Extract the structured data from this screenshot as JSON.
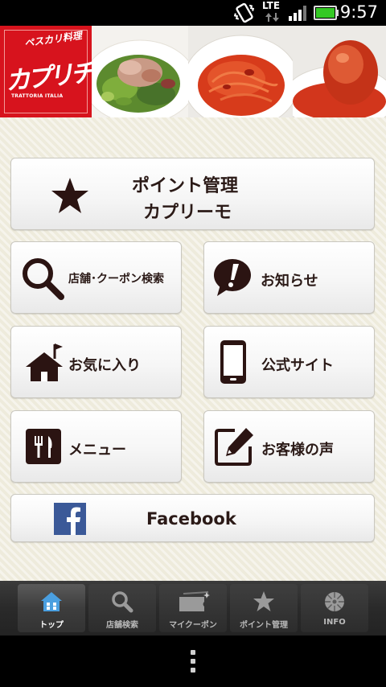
{
  "status_bar": {
    "time": "9:57",
    "network": "LTE",
    "icons": [
      "vibrate-icon",
      "lte-data-icon",
      "signal-icon",
      "battery-icon"
    ],
    "battery_color": "#34c924"
  },
  "header": {
    "logo": {
      "top_text": "ペスカリ料理",
      "name": "カプリチョーザ",
      "subtext": "TRATTORIA ITALIA",
      "color": "#d7131d"
    },
    "photos": [
      "salad-photo",
      "spaghetti-tomato-photo",
      "rice-ball-tomato-photo"
    ]
  },
  "menu": {
    "points": {
      "line1": "ポイント管理",
      "line2": "カプリーモ",
      "icon": "star-icon"
    },
    "store_search": {
      "label": "店舗･クーポン検索",
      "icon": "search-icon"
    },
    "news": {
      "label": "お知らせ",
      "icon": "exclamation-bubble-icon"
    },
    "favorites": {
      "label": "お気に入り",
      "icon": "house-flag-icon"
    },
    "official_site": {
      "label": "公式サイト",
      "icon": "smartphone-icon"
    },
    "menu_page": {
      "label": "メニュー",
      "icon": "fork-knife-icon"
    },
    "feedback": {
      "label": "お客様の声",
      "icon": "edit-note-icon"
    },
    "facebook": {
      "label": "Facebook",
      "icon": "facebook-icon",
      "color": "#3b5998"
    }
  },
  "tabs": [
    {
      "label": "トップ",
      "icon": "home-icon",
      "active": true
    },
    {
      "label": "店舗検索",
      "icon": "search-icon",
      "active": false
    },
    {
      "label": "マイクーポン",
      "icon": "coupon-icon",
      "active": false
    },
    {
      "label": "ポイント管理",
      "icon": "star-icon",
      "active": false
    },
    {
      "label": "INFO",
      "icon": "gear-icon",
      "active": false
    }
  ],
  "colors": {
    "text_dark": "#2b1a17",
    "icon_dark": "#2b1412",
    "background": "#eeebdc",
    "tabbar": "#2a2a2a",
    "tab_home_icon": "#4a9fe0"
  }
}
